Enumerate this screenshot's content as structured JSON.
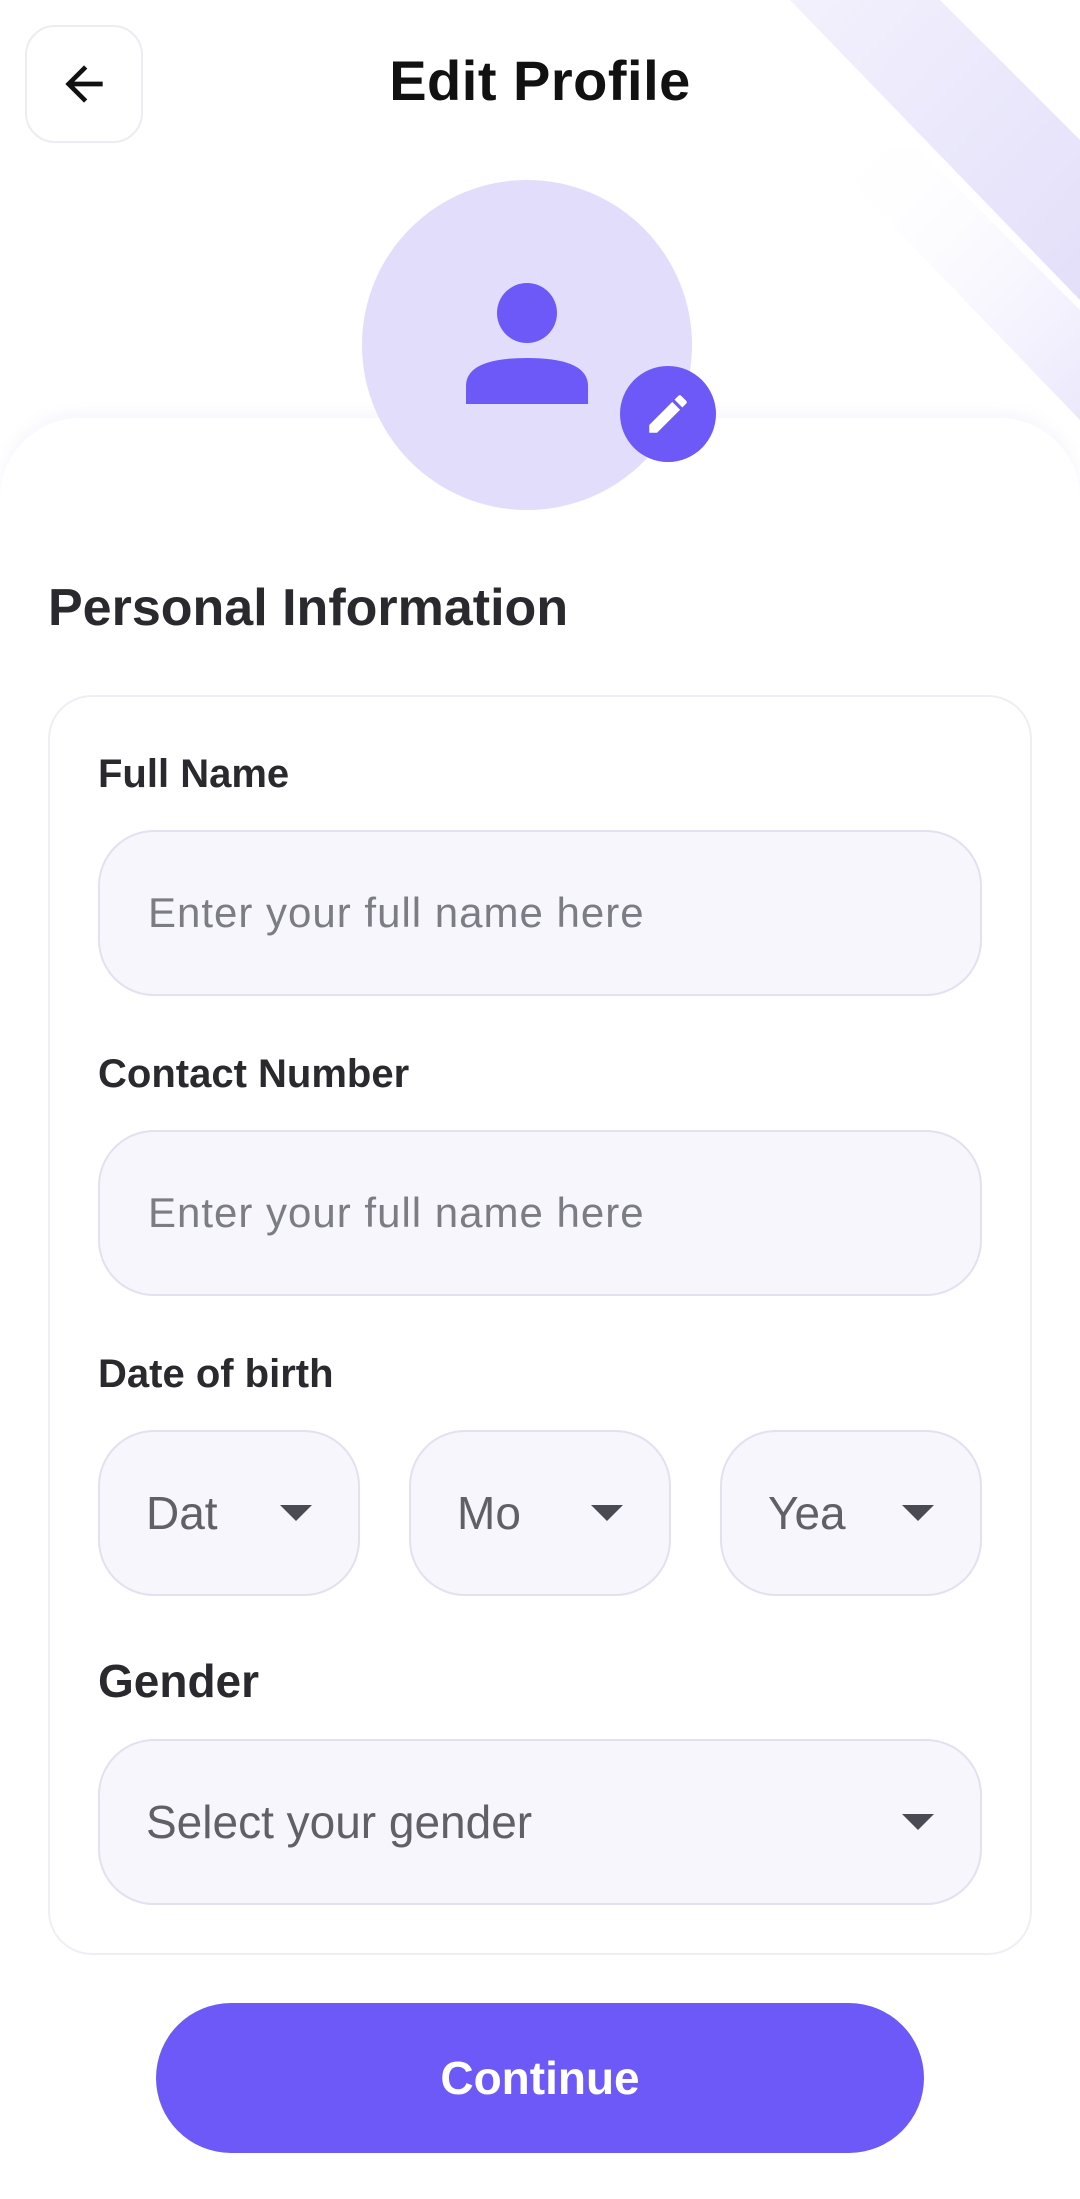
{
  "header": {
    "title": "Edit Profile",
    "back_icon": "arrow-left-icon"
  },
  "avatar": {
    "icon": "person-icon",
    "edit_icon": "pencil-icon"
  },
  "section": {
    "title": "Personal Information"
  },
  "form": {
    "full_name": {
      "label": "Full Name",
      "value": "",
      "placeholder": "Enter your full name here"
    },
    "contact_number": {
      "label": "Contact Number",
      "value": "",
      "placeholder": "Enter your full name here"
    },
    "date_of_birth": {
      "label": "Date of birth",
      "date_placeholder": "Dat",
      "month_placeholder": "Mo",
      "year_placeholder": "Yea"
    },
    "gender": {
      "label": "Gender",
      "placeholder": "Select your gender"
    }
  },
  "actions": {
    "continue_label": "Continue"
  },
  "colors": {
    "accent": "#6c59f8",
    "avatar_bg": "#e1ddfb",
    "input_bg": "#f7f6fc",
    "input_border": "#e3e1ee"
  }
}
